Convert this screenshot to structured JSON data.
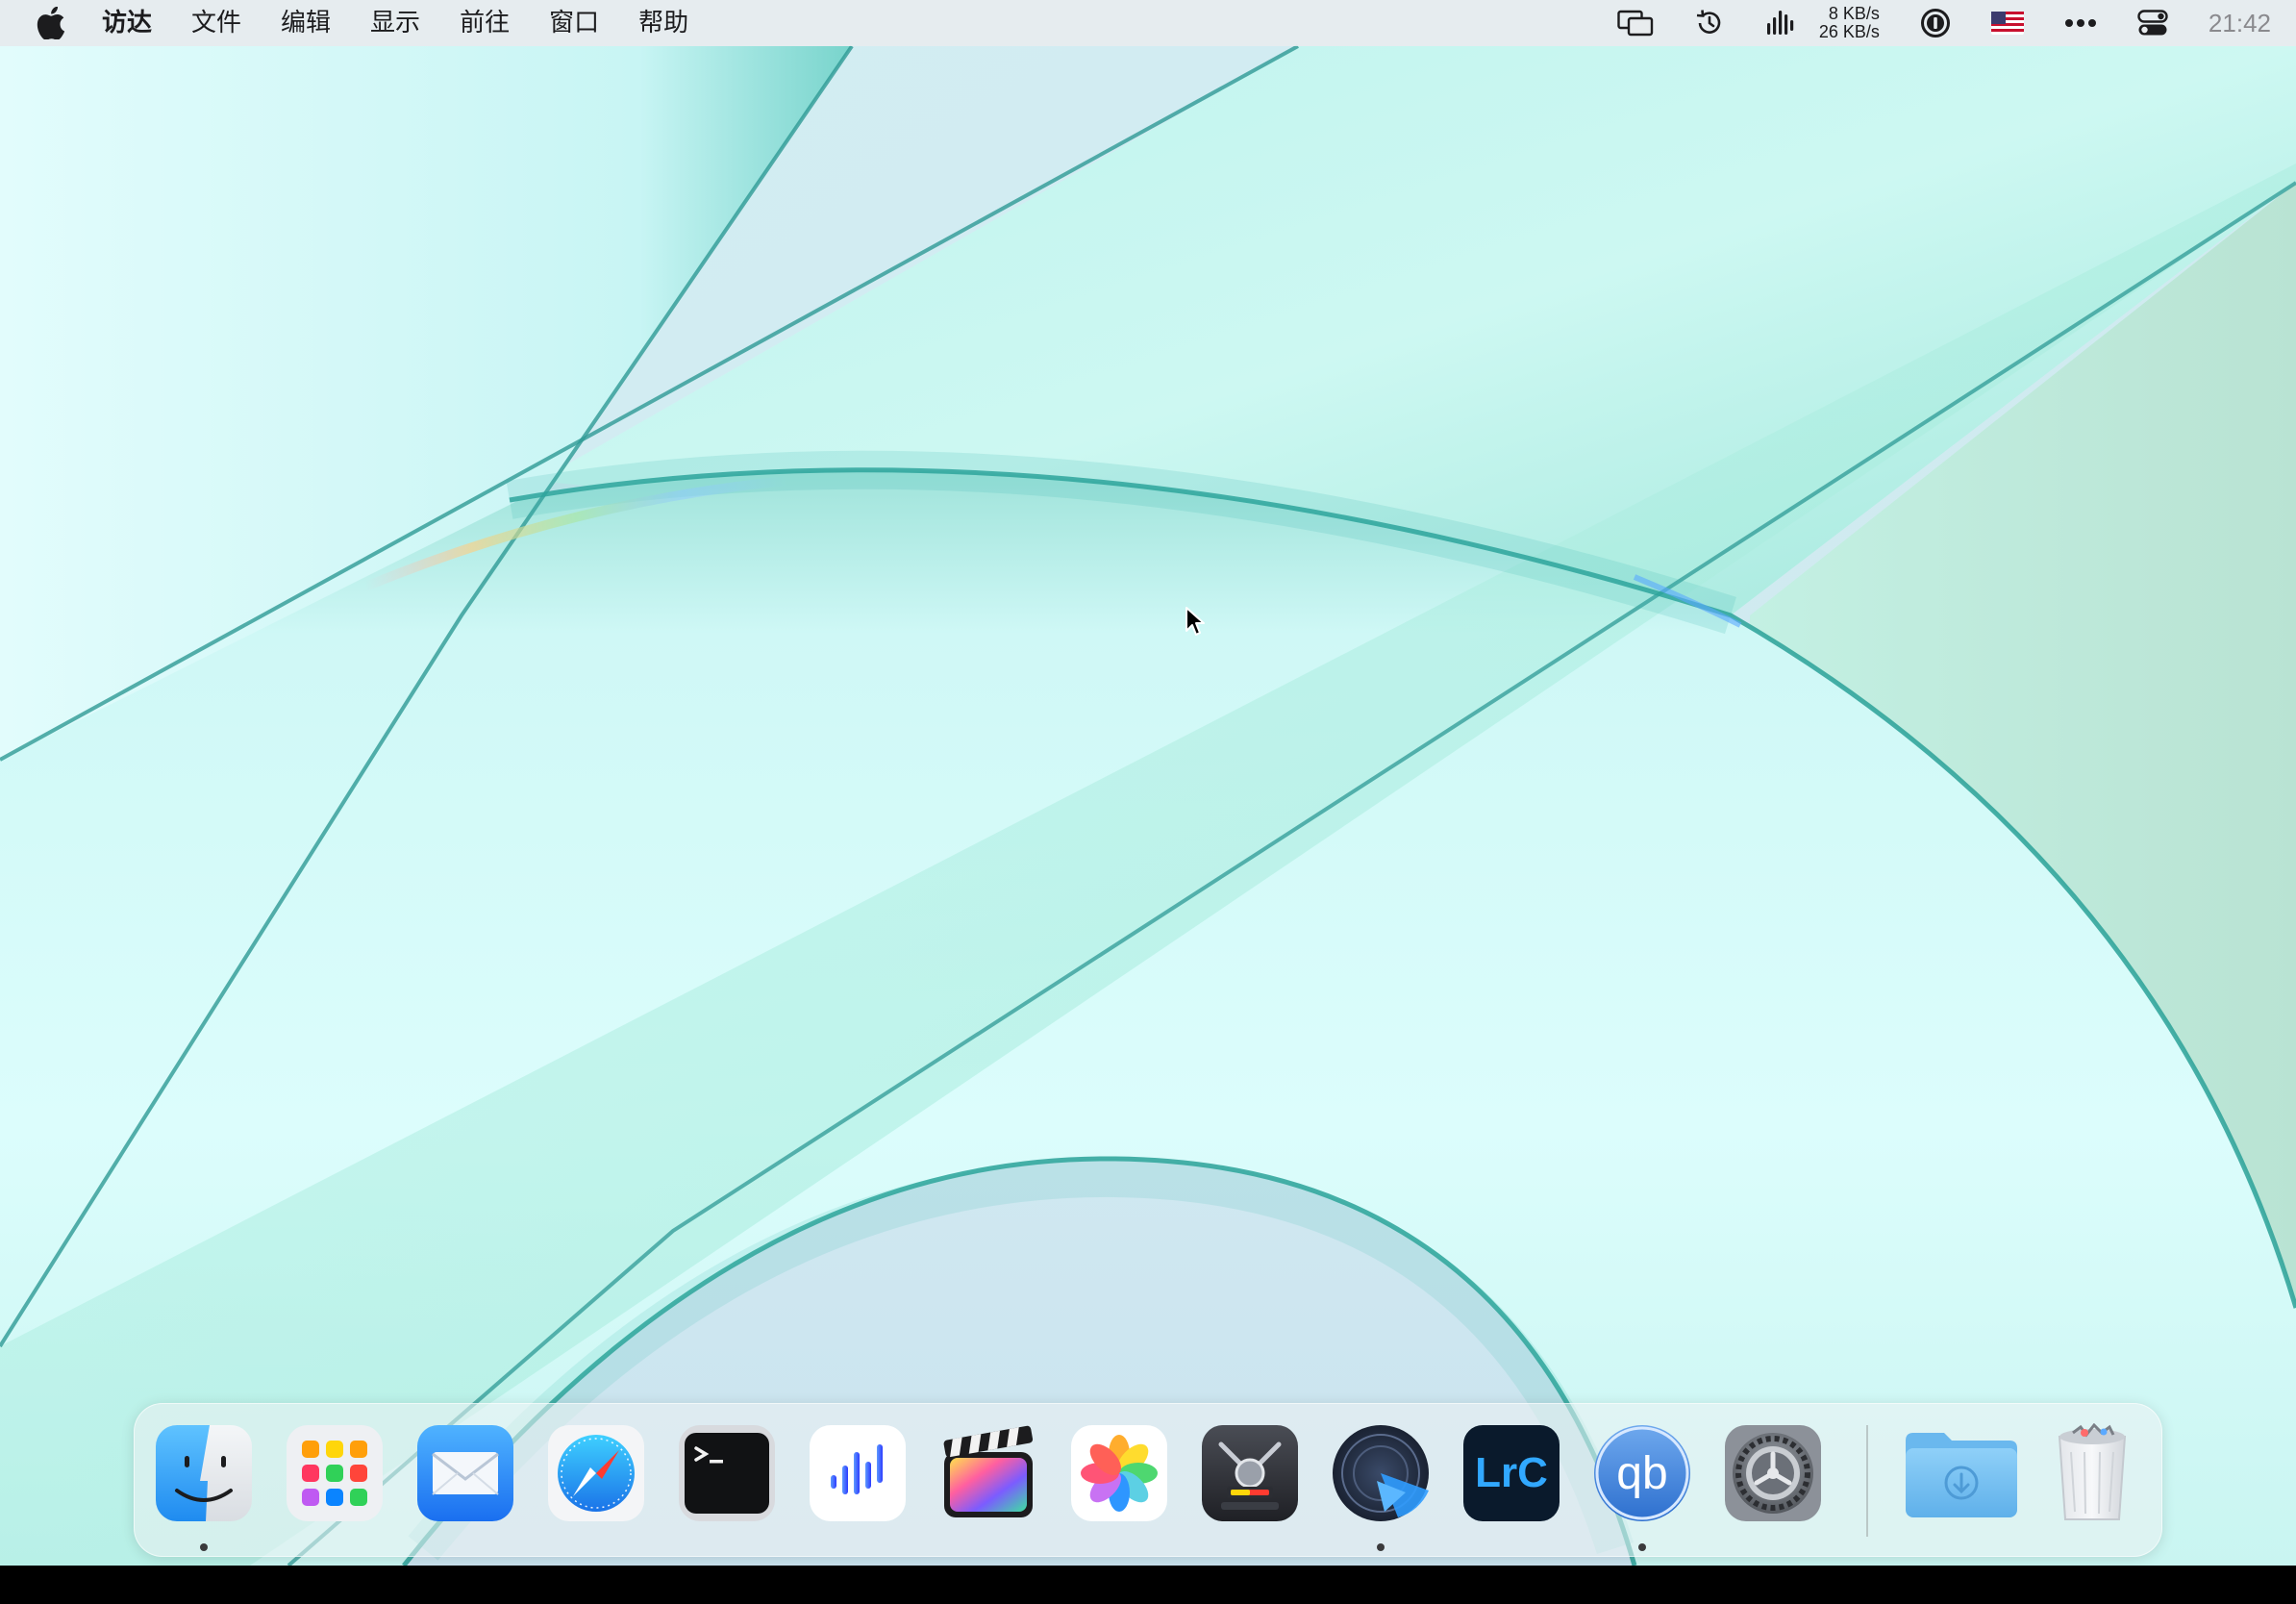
{
  "menubar": {
    "apple_icon": "apple-logo-icon",
    "items": [
      {
        "label": "访达",
        "bold": true
      },
      {
        "label": "文件"
      },
      {
        "label": "编辑"
      },
      {
        "label": "显示"
      },
      {
        "label": "前往"
      },
      {
        "label": "窗口"
      },
      {
        "label": "帮助"
      }
    ],
    "status": {
      "icons": [
        "display-mirroring-icon",
        "time-machine-icon",
        "audio-level-icon"
      ],
      "net_upload": "8 KB/s",
      "net_download": "26 KB/s",
      "more_icons": [
        "password-manager-icon",
        "us-flag-icon",
        "more-dots-icon",
        "control-center-icon"
      ],
      "clock": "21:42"
    }
  },
  "dock": {
    "apps": [
      {
        "name": "finder",
        "running": true
      },
      {
        "name": "launchpad",
        "running": false
      },
      {
        "name": "mail",
        "running": false
      },
      {
        "name": "safari",
        "running": false
      },
      {
        "name": "terminal",
        "running": false
      },
      {
        "name": "voice-memos",
        "running": false
      },
      {
        "name": "final-cut-pro",
        "running": false
      },
      {
        "name": "photos",
        "running": false
      },
      {
        "name": "compressor",
        "running": false
      },
      {
        "name": "motion",
        "running": true
      },
      {
        "name": "lightroom-classic",
        "running": false,
        "label": "LrC"
      },
      {
        "name": "qbittorrent",
        "running": true,
        "label": "qb"
      },
      {
        "name": "system-preferences",
        "running": false
      }
    ],
    "stacks": [
      {
        "name": "downloads-folder"
      },
      {
        "name": "trash"
      }
    ]
  },
  "colors": {
    "wallpaper_light": "#dcfbfc",
    "wallpaper_teal": "#3fb9b0",
    "wallpaper_blue": "#cde7f2",
    "menubar_bg": "#e8ecee",
    "dock_bg": "#ecf0f2"
  }
}
